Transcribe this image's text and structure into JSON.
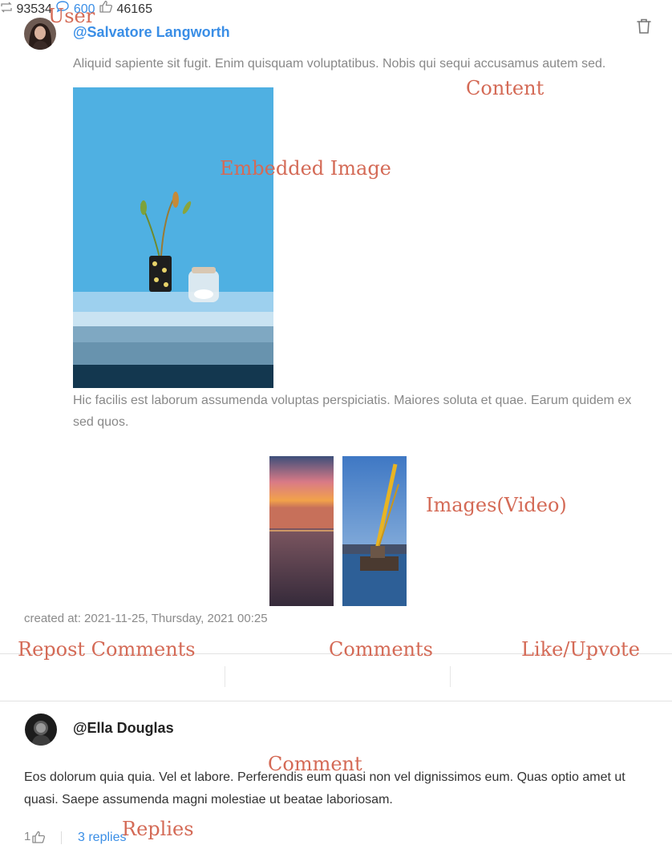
{
  "annotations": {
    "user": "User",
    "content": "Content",
    "embedded_image": "Embedded Image",
    "images_video": "Images(Video)",
    "repost_comments": "Repost Comments",
    "comments": "Comments",
    "like_upvote": "Like/Upvote",
    "comment": "Comment",
    "replies": "Replies"
  },
  "post": {
    "username": "@Salvatore Langworth",
    "text1": "Aliquid sapiente sit fugit. Enim quisquam voluptatibus. Nobis qui sequi accusamus autem sed.",
    "text2": "Hic facilis est laborum assumenda voluptas perspiciatis. Maiores soluta et quae. Earum quidem ex sed quos.",
    "created_at": "created at: 2021-11-25, Thursday, 2021 00:25",
    "delete_icon": "trash-icon"
  },
  "stats": {
    "reposts": "93534",
    "comments": "600",
    "likes": "46165",
    "repost_icon": "repost-icon",
    "comment_icon": "comment-icon",
    "like_icon": "thumbs-up-icon"
  },
  "comment": {
    "username": "@Ella Douglas",
    "text": "Eos dolorum quia quia. Vel et labore. Perferendis eum quasi non vel dignissimos eum. Quas optio amet ut quasi. Saepe assumenda magni molestiae ut beatae laboriosam.",
    "likes": "1",
    "replies": "3 replies"
  },
  "colors": {
    "link": "#3a8ee6",
    "muted": "#8a8a8a",
    "annotation": "#d46a56"
  }
}
